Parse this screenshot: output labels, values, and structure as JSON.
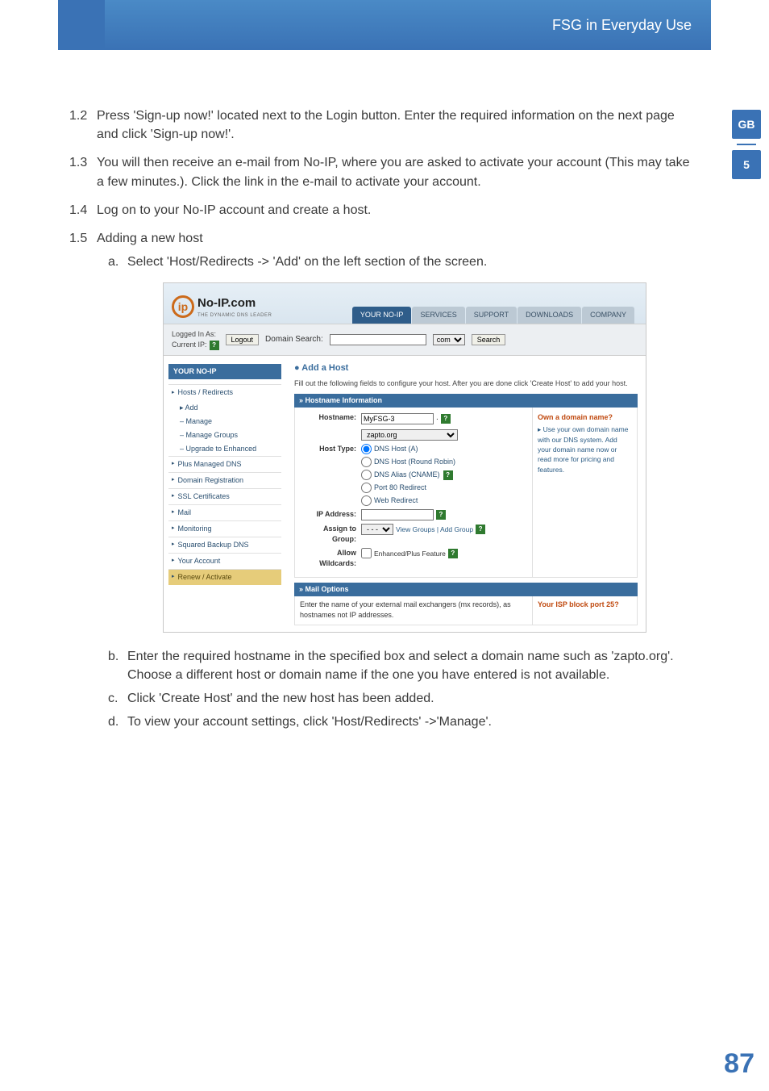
{
  "header": {
    "title": "FSG in Everyday Use"
  },
  "badges": {
    "lang": "GB",
    "chapter": "5"
  },
  "steps": {
    "s12": {
      "num": "1.2",
      "text": "Press 'Sign-up now!' located next to the Login button. Enter the required information on the next page and click 'Sign-up now!'."
    },
    "s13": {
      "num": "1.3",
      "text": "You will then receive an e-mail from No-IP, where you are asked to activate your account (This may take a few minutes.). Click the link in the e-mail to activate your account."
    },
    "s14": {
      "num": "1.4",
      "text": "Log on to your No-IP account and create a host."
    },
    "s15": {
      "num": "1.5",
      "text": "Adding a new host"
    },
    "a": {
      "label": "a.",
      "text": "Select 'Host/Redirects -> 'Add' on the left section of the screen."
    },
    "b": {
      "label": "b.",
      "text": "Enter the required hostname in the specified box and select a domain name such as 'zapto.org'. Choose a different host or domain name if the one you have entered is not available."
    },
    "c": {
      "label": "c.",
      "text": "Click 'Create Host' and the new host has been added."
    },
    "d": {
      "label": "d.",
      "text": "To view your account settings, click 'Host/Redirects' ->'Manage'."
    }
  },
  "noip": {
    "logo": {
      "name": "No-IP.com",
      "sub": "THE DYNAMIC DNS LEADER"
    },
    "tabs": [
      "YOUR NO-IP",
      "SERVICES",
      "SUPPORT",
      "DOWNLOADS",
      "COMPANY"
    ],
    "logged_label": "Logged In As:",
    "current_ip": "Current IP:",
    "logout": "Logout",
    "domain_search": "Domain Search:",
    "tld": "com",
    "search": "Search",
    "left_header": "YOUR NO-IP",
    "nav": {
      "hosts": "Hosts / Redirects",
      "add": "Add",
      "manage": "Manage",
      "manage_groups": "Manage Groups",
      "upgrade": "Upgrade to Enhanced",
      "plus": "Plus Managed DNS",
      "domain_reg": "Domain Registration",
      "ssl": "SSL Certificates",
      "mail": "Mail",
      "monitoring": "Monitoring",
      "squared": "Squared Backup DNS",
      "account": "Your Account",
      "renew": "Renew / Activate"
    },
    "add_host": {
      "title": "● Add a Host",
      "desc": "Fill out the following fields to configure your host. After you are done click 'Create Host' to add your host.",
      "hostname_bar": "» Hostname Information",
      "hostname_label": "Hostname:",
      "hostname_value": "MyFSG-3",
      "domain_value": "zapto.org",
      "hosttype_label": "Host Type:",
      "ht_a": "DNS Host (A)",
      "ht_rr": "DNS Host (Round Robin)",
      "ht_cname": "DNS Alias (CNAME)",
      "ht_port80": "Port 80 Redirect",
      "ht_web": "Web Redirect",
      "ip_label": "IP Address:",
      "assign_label": "Assign to Group:",
      "assign_links": "View Groups | Add Group",
      "wildcards_label": "Allow Wildcards:",
      "wildcards_note": "Enhanced/Plus Feature",
      "own_title": "Own a domain name?",
      "own_text": "▸ Use your own domain name with our DNS system. Add your domain name now or read more for pricing and features.",
      "mail_bar": "» Mail Options",
      "mail_text": "Enter the name of your external mail exchangers (mx records), as hostnames not IP addresses.",
      "mail_right": "Your ISP block port 25?"
    }
  },
  "page_number": "87"
}
